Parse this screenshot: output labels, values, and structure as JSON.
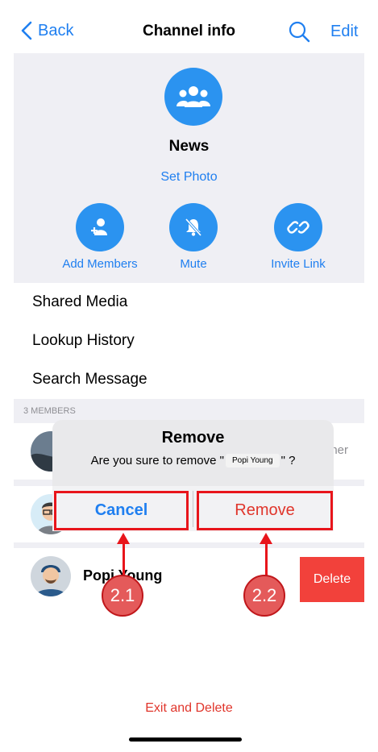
{
  "nav": {
    "back_label": "Back",
    "title": "Channel info",
    "edit_label": "Edit"
  },
  "channel": {
    "name": "News",
    "set_photo_label": "Set Photo"
  },
  "actions": [
    {
      "label": "Add Members",
      "icon": "add-member-icon"
    },
    {
      "label": "Mute",
      "icon": "bell-muted-icon"
    },
    {
      "label": "Invite Link",
      "icon": "link-icon"
    }
  ],
  "menu": {
    "items": [
      "Shared Media",
      "Lookup History",
      "Search Message"
    ]
  },
  "members": {
    "header": "3 MEMBERS",
    "list": [
      {
        "name": "",
        "role": "Owner"
      },
      {
        "name": ""
      },
      {
        "name": "Popi Young"
      }
    ]
  },
  "swipe": {
    "delete_label": "Delete"
  },
  "alert": {
    "title": "Remove",
    "message_prefix": "Are you sure to remove \"",
    "message_name": "Popi Young",
    "message_suffix": "\" ?",
    "cancel_label": "Cancel",
    "remove_label": "Remove"
  },
  "footer": {
    "exit_label": "Exit and Delete"
  },
  "annotations": {
    "step_cancel": "2.1",
    "step_remove": "2.2"
  },
  "colors": {
    "accent": "#1f7ff0",
    "destructive": "#e0352b",
    "delete_bg": "#f2413b",
    "annotation": "#e8151b"
  }
}
